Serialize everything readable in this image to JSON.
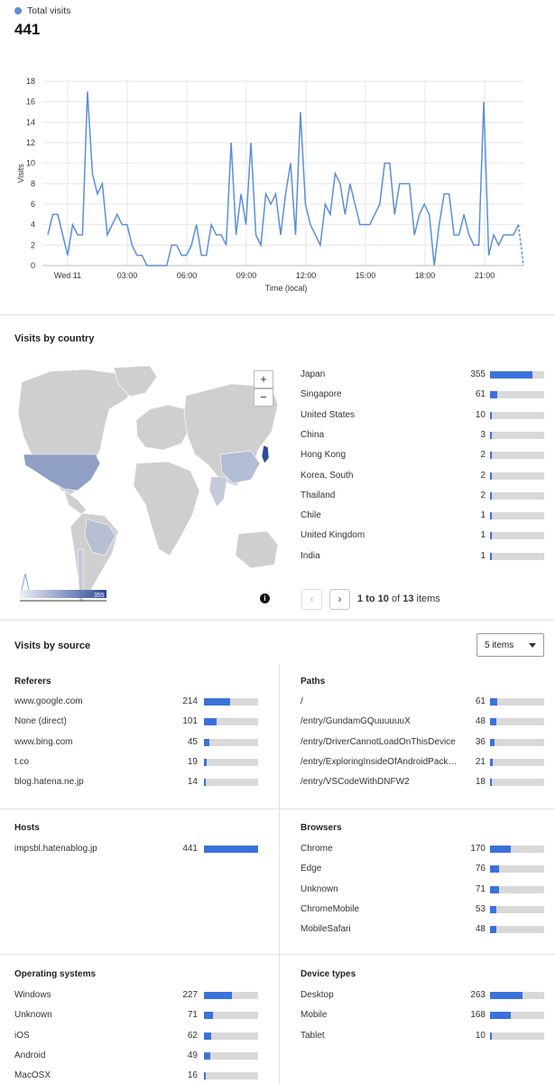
{
  "total_visits": {
    "label": "Total visits",
    "value": "441",
    "color": "#5b8fd8"
  },
  "chart_data": {
    "type": "line",
    "ylabel": "Visits",
    "xlabel": "Time (local)",
    "ylim": [
      0,
      18
    ],
    "yticks": [
      "0",
      "2",
      "4",
      "6",
      "8",
      "10",
      "12",
      "14",
      "16",
      "18"
    ],
    "xticks": [
      "Wed 11",
      "03:00",
      "06:00",
      "09:00",
      "12:00",
      "15:00",
      "18:00",
      "21:00"
    ],
    "grid": true,
    "series": [
      {
        "values": [
          3,
          5,
          5,
          3,
          1,
          4,
          3,
          3,
          17,
          9,
          7,
          8,
          3,
          4,
          5,
          4,
          4,
          2,
          1,
          1,
          0,
          0,
          0,
          0,
          0,
          2,
          2,
          1,
          1,
          2,
          4,
          1,
          1,
          4,
          3,
          3,
          2,
          12,
          3,
          7,
          4,
          12,
          3,
          2,
          7,
          6,
          7,
          3,
          7,
          10,
          3,
          15,
          6,
          4,
          3,
          2,
          6,
          5,
          9,
          8,
          5,
          8,
          6,
          4,
          4,
          4,
          5,
          6,
          10,
          10,
          5,
          8,
          8,
          8,
          3,
          5,
          6,
          5,
          0,
          4,
          7,
          7,
          3,
          3,
          5,
          3,
          2,
          2,
          16,
          1,
          3,
          2,
          3,
          3,
          3,
          4,
          0
        ]
      }
    ]
  },
  "country": {
    "title": "Visits by country",
    "legend_min": "1",
    "legend_max": "355",
    "rows": [
      {
        "label": "Japan",
        "value": "355",
        "frac": 0.78
      },
      {
        "label": "Singapore",
        "value": "61",
        "frac": 0.13
      },
      {
        "label": "United States",
        "value": "10",
        "frac": 0.03
      },
      {
        "label": "China",
        "value": "3",
        "frac": 0.02
      },
      {
        "label": "Hong Kong",
        "value": "2",
        "frac": 0.02
      },
      {
        "label": "Korea, South",
        "value": "2",
        "frac": 0.02
      },
      {
        "label": "Thailand",
        "value": "2",
        "frac": 0.02
      },
      {
        "label": "Chile",
        "value": "1",
        "frac": 0.015
      },
      {
        "label": "United Kingdom",
        "value": "1",
        "frac": 0.015
      },
      {
        "label": "India",
        "value": "1",
        "frac": 0.015
      }
    ],
    "pager": {
      "prev": "‹",
      "next": "›",
      "from": "1",
      "to_word": "to",
      "to": "10",
      "of_word": "of",
      "total": "13",
      "suffix": "items"
    }
  },
  "source": {
    "title": "Visits by source",
    "select_value": "5 items",
    "referers": {
      "title": "Referers",
      "rows": [
        {
          "label": "www.google.com",
          "value": "214",
          "frac": 0.49
        },
        {
          "label": "None (direct)",
          "value": "101",
          "frac": 0.23
        },
        {
          "label": "www.bing.com",
          "value": "45",
          "frac": 0.1
        },
        {
          "label": "t.co",
          "value": "19",
          "frac": 0.045
        },
        {
          "label": "blog.hatena.ne.jp",
          "value": "14",
          "frac": 0.035
        }
      ]
    },
    "paths": {
      "title": "Paths",
      "rows": [
        {
          "label": "/",
          "value": "61",
          "frac": 0.14
        },
        {
          "label": "/entry/GundamGQuuuuuuX",
          "value": "48",
          "frac": 0.11
        },
        {
          "label": "/entry/DriverCannotLoadOnThisDevice",
          "value": "36",
          "frac": 0.085
        },
        {
          "label": "/entry/ExploringInsideOfAndroidPack…",
          "value": "21",
          "frac": 0.05
        },
        {
          "label": "/entry/VSCodeWithDNFW2",
          "value": "18",
          "frac": 0.04
        }
      ]
    },
    "hosts": {
      "title": "Hosts",
      "rows": [
        {
          "label": "impsbl.hatenablog.jp",
          "value": "441",
          "frac": 1.0
        }
      ]
    },
    "browsers": {
      "title": "Browsers",
      "rows": [
        {
          "label": "Chrome",
          "value": "170",
          "frac": 0.39
        },
        {
          "label": "Edge",
          "value": "76",
          "frac": 0.17
        },
        {
          "label": "Unknown",
          "value": "71",
          "frac": 0.16
        },
        {
          "label": "ChromeMobile",
          "value": "53",
          "frac": 0.12
        },
        {
          "label": "MobileSafari",
          "value": "48",
          "frac": 0.11
        }
      ]
    },
    "os": {
      "title": "Operating systems",
      "rows": [
        {
          "label": "Windows",
          "value": "227",
          "frac": 0.52
        },
        {
          "label": "Unknown",
          "value": "71",
          "frac": 0.16
        },
        {
          "label": "iOS",
          "value": "62",
          "frac": 0.14
        },
        {
          "label": "Android",
          "value": "49",
          "frac": 0.11
        },
        {
          "label": "MacOSX",
          "value": "16",
          "frac": 0.04
        }
      ]
    },
    "devices": {
      "title": "Device types",
      "rows": [
        {
          "label": "Desktop",
          "value": "263",
          "frac": 0.6
        },
        {
          "label": "Mobile",
          "value": "168",
          "frac": 0.38
        },
        {
          "label": "Tablet",
          "value": "10",
          "frac": 0.025
        }
      ]
    }
  }
}
